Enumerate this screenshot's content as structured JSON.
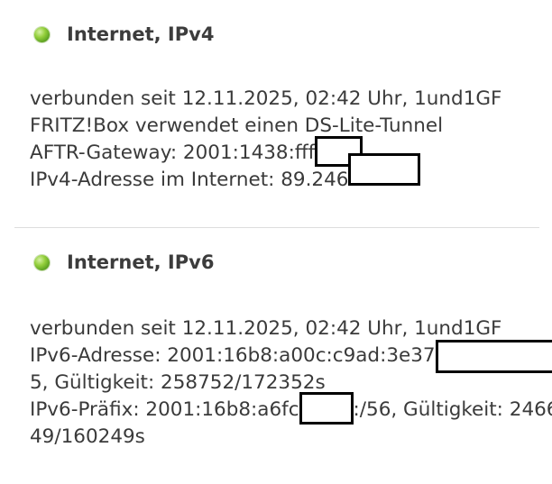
{
  "colors": {
    "status_led": "#7cc033",
    "redaction_border": "#000000",
    "divider": "#dddddd"
  },
  "ipv4": {
    "title": "Internet, IPv4",
    "status_icon": "green-status-dot-icon",
    "connected_since": "verbunden seit 12.11.2025, 02:42 Uhr, 1und1GF",
    "ds_lite": "FRITZ!Box verwendet einen DS-Lite-Tunnel",
    "aftr_gateway": "AFTR-Gateway: 2001:1438:fff",
    "ipv4_address": "IPv4-Adresse im Internet: 89.246"
  },
  "ipv6": {
    "title": "Internet, IPv6",
    "status_icon": "green-status-dot-icon",
    "connected_since": "verbunden seit 12.11.2025, 02:42 Uhr, 1und1GF",
    "address_prefix": "IPv6-Adresse: 2001:16b8:a00c:c9ad:3e37",
    "address_suffix": "5, Gültigkeit: 258752/172352s",
    "prefix_start": "IPv6-Präfix: 2001:16b8:a6fc",
    "prefix_end": ":/56, Gültigkeit: 2466",
    "prefix_cont": "49/160249s"
  }
}
